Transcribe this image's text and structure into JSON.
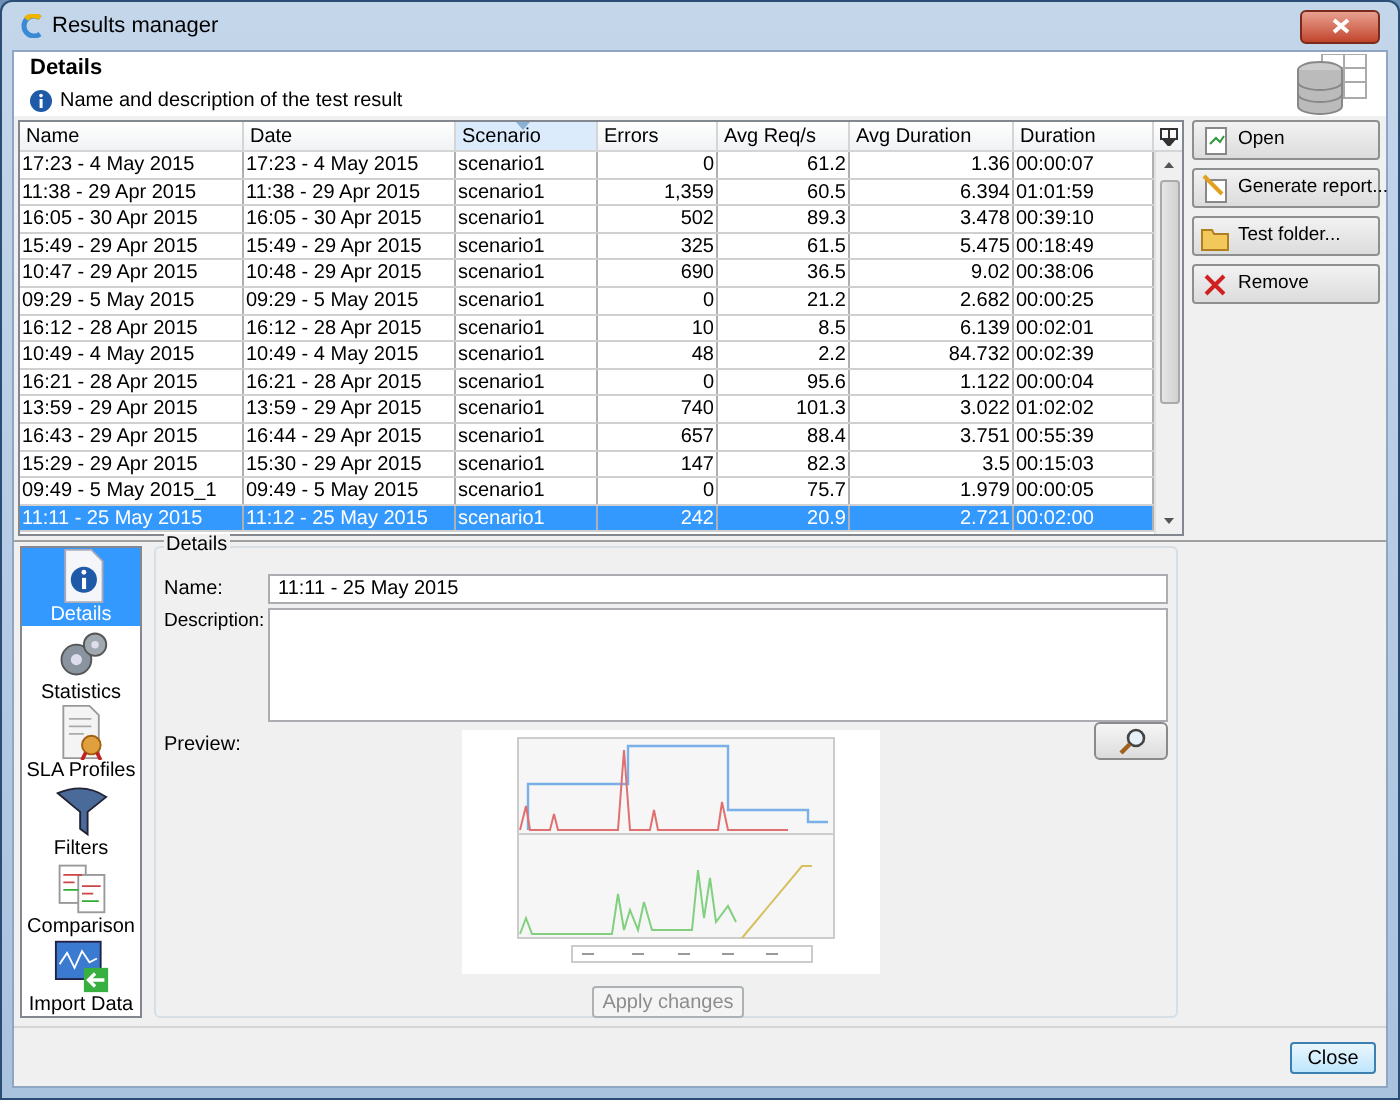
{
  "window": {
    "title": "Results manager"
  },
  "header": {
    "title": "Details",
    "subtitle": "Name and description of the test result"
  },
  "table": {
    "columns": [
      {
        "label": "Name",
        "kind": "text",
        "sorted": false
      },
      {
        "label": "Date",
        "kind": "text",
        "sorted": false
      },
      {
        "label": "Scenario",
        "kind": "text",
        "sorted": true
      },
      {
        "label": "Errors",
        "kind": "number",
        "sorted": false
      },
      {
        "label": "Avg Req/s",
        "kind": "number",
        "sorted": false
      },
      {
        "label": "Avg Duration",
        "kind": "number",
        "sorted": false
      },
      {
        "label": "Duration",
        "kind": "text",
        "sorted": false
      }
    ],
    "rows": [
      {
        "cells": [
          "17:23 - 4 May 2015",
          "17:23 - 4 May 2015",
          "scenario1",
          "0",
          "61.2",
          "1.36",
          "00:00:07"
        ],
        "selected": false
      },
      {
        "cells": [
          "11:38 - 29 Apr 2015",
          "11:38 - 29 Apr 2015",
          "scenario1",
          "1,359",
          "60.5",
          "6.394",
          "01:01:59"
        ],
        "selected": false
      },
      {
        "cells": [
          "16:05 - 30 Apr 2015",
          "16:05 - 30 Apr 2015",
          "scenario1",
          "502",
          "89.3",
          "3.478",
          "00:39:10"
        ],
        "selected": false
      },
      {
        "cells": [
          "15:49 - 29 Apr 2015",
          "15:49 - 29 Apr 2015",
          "scenario1",
          "325",
          "61.5",
          "5.475",
          "00:18:49"
        ],
        "selected": false
      },
      {
        "cells": [
          "10:47 - 29 Apr 2015",
          "10:48 - 29 Apr 2015",
          "scenario1",
          "690",
          "36.5",
          "9.02",
          "00:38:06"
        ],
        "selected": false
      },
      {
        "cells": [
          "09:29 - 5 May 2015",
          "09:29 - 5 May 2015",
          "scenario1",
          "0",
          "21.2",
          "2.682",
          "00:00:25"
        ],
        "selected": false
      },
      {
        "cells": [
          "16:12 - 28 Apr 2015",
          "16:12 - 28 Apr 2015",
          "scenario1",
          "10",
          "8.5",
          "6.139",
          "00:02:01"
        ],
        "selected": false
      },
      {
        "cells": [
          "10:49 - 4 May 2015",
          "10:49 - 4 May 2015",
          "scenario1",
          "48",
          "2.2",
          "84.732",
          "00:02:39"
        ],
        "selected": false
      },
      {
        "cells": [
          "16:21 - 28 Apr 2015",
          "16:21 - 28 Apr 2015",
          "scenario1",
          "0",
          "95.6",
          "1.122",
          "00:00:04"
        ],
        "selected": false
      },
      {
        "cells": [
          "13:59 - 29 Apr 2015",
          "13:59 - 29 Apr 2015",
          "scenario1",
          "740",
          "101.3",
          "3.022",
          "01:02:02"
        ],
        "selected": false
      },
      {
        "cells": [
          "16:43 - 29 Apr 2015",
          "16:44 - 29 Apr 2015",
          "scenario1",
          "657",
          "88.4",
          "3.751",
          "00:55:39"
        ],
        "selected": false
      },
      {
        "cells": [
          "15:29 - 29 Apr 2015",
          "15:30 - 29 Apr 2015",
          "scenario1",
          "147",
          "82.3",
          "3.5",
          "00:15:03"
        ],
        "selected": false
      },
      {
        "cells": [
          "09:49 - 5 May 2015_1",
          "09:49 - 5 May 2015",
          "scenario1",
          "0",
          "75.7",
          "1.979",
          "00:00:05"
        ],
        "selected": false
      },
      {
        "cells": [
          "11:11 - 25 May 2015",
          "11:12 - 25 May 2015",
          "scenario1",
          "242",
          "20.9",
          "2.721",
          "00:02:00"
        ],
        "selected": true
      }
    ]
  },
  "actions": [
    {
      "label": "Open",
      "kind": "open"
    },
    {
      "label": "Generate report...",
      "kind": "report"
    },
    {
      "label": "Test folder...",
      "kind": "folder"
    },
    {
      "label": "Remove",
      "kind": "remove"
    }
  ],
  "sidebar": {
    "items": [
      {
        "label": "Details",
        "kind": "details",
        "selected": true
      },
      {
        "label": "Statistics",
        "kind": "statistics",
        "selected": false
      },
      {
        "label": "SLA Profiles",
        "kind": "sla",
        "selected": false
      },
      {
        "label": "Filters",
        "kind": "filters",
        "selected": false
      },
      {
        "label": "Comparison",
        "kind": "comparison",
        "selected": false
      },
      {
        "label": "Import Data",
        "kind": "import",
        "selected": false
      }
    ]
  },
  "details": {
    "group_label": "Details",
    "name_label": "Name:",
    "name_value": "11:11 - 25 May 2015",
    "description_label": "Description:",
    "preview_label": "Preview:",
    "apply_button": {
      "label": "Apply changes",
      "disabled": true
    }
  },
  "close_button": {
    "label": "Close"
  }
}
